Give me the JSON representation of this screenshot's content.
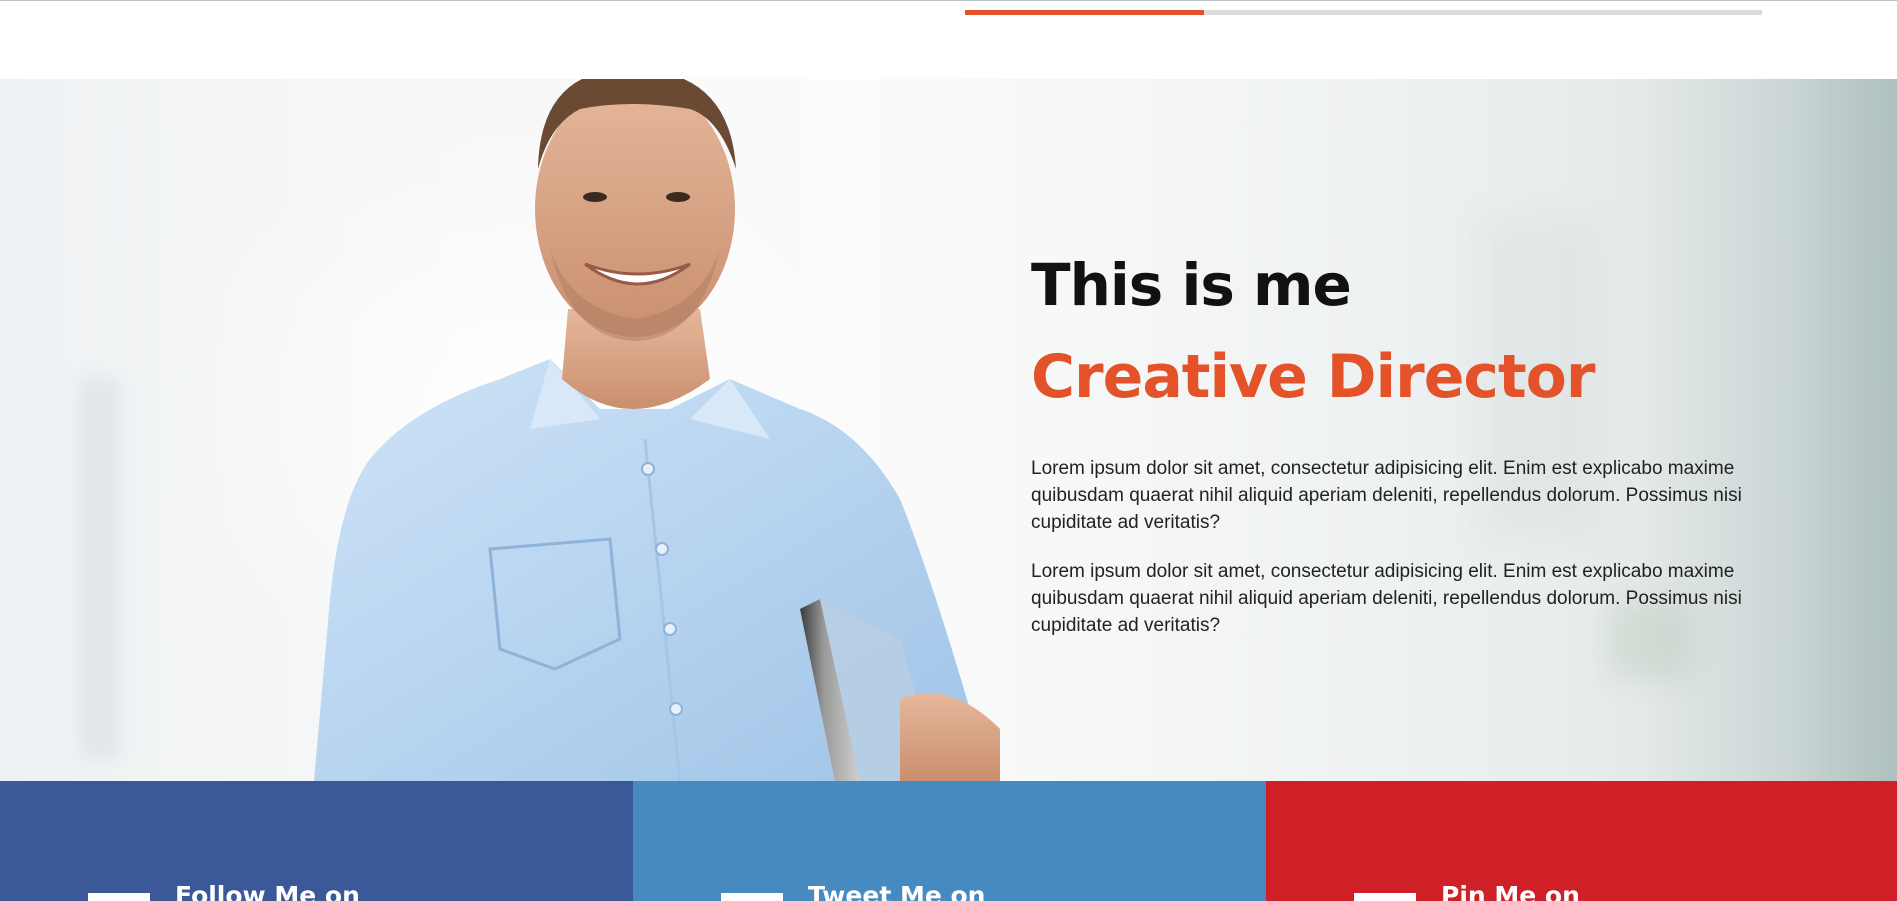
{
  "progress": {
    "value": 0.3
  },
  "hero": {
    "title": "This is me",
    "subtitle": "Creative Director",
    "paragraphs": [
      "Lorem ipsum dolor sit amet, consectetur adipisicing elit. Enim est explicabo maxime quibusdam quaerat nihil aliquid aperiam deleniti, repellendus dolorum. Possimus nisi cupiditate ad veritatis?",
      "Lorem ipsum dolor sit amet, consectetur adipisicing elit. Enim est explicabo maxime quibusdam quaerat nihil aliquid aperiam deleniti, repellendus dolorum. Possimus nisi cupiditate ad veritatis?"
    ]
  },
  "social": [
    {
      "label": "Follow Me on",
      "color": "#3b5998",
      "icon": "facebook-icon"
    },
    {
      "label": "Tweet Me on",
      "color": "#478ac0",
      "icon": "twitter-icon"
    },
    {
      "label": "Pin Me on",
      "color": "#cf2027",
      "icon": "pinterest-icon"
    }
  ],
  "colors": {
    "accent": "#e4522a"
  }
}
